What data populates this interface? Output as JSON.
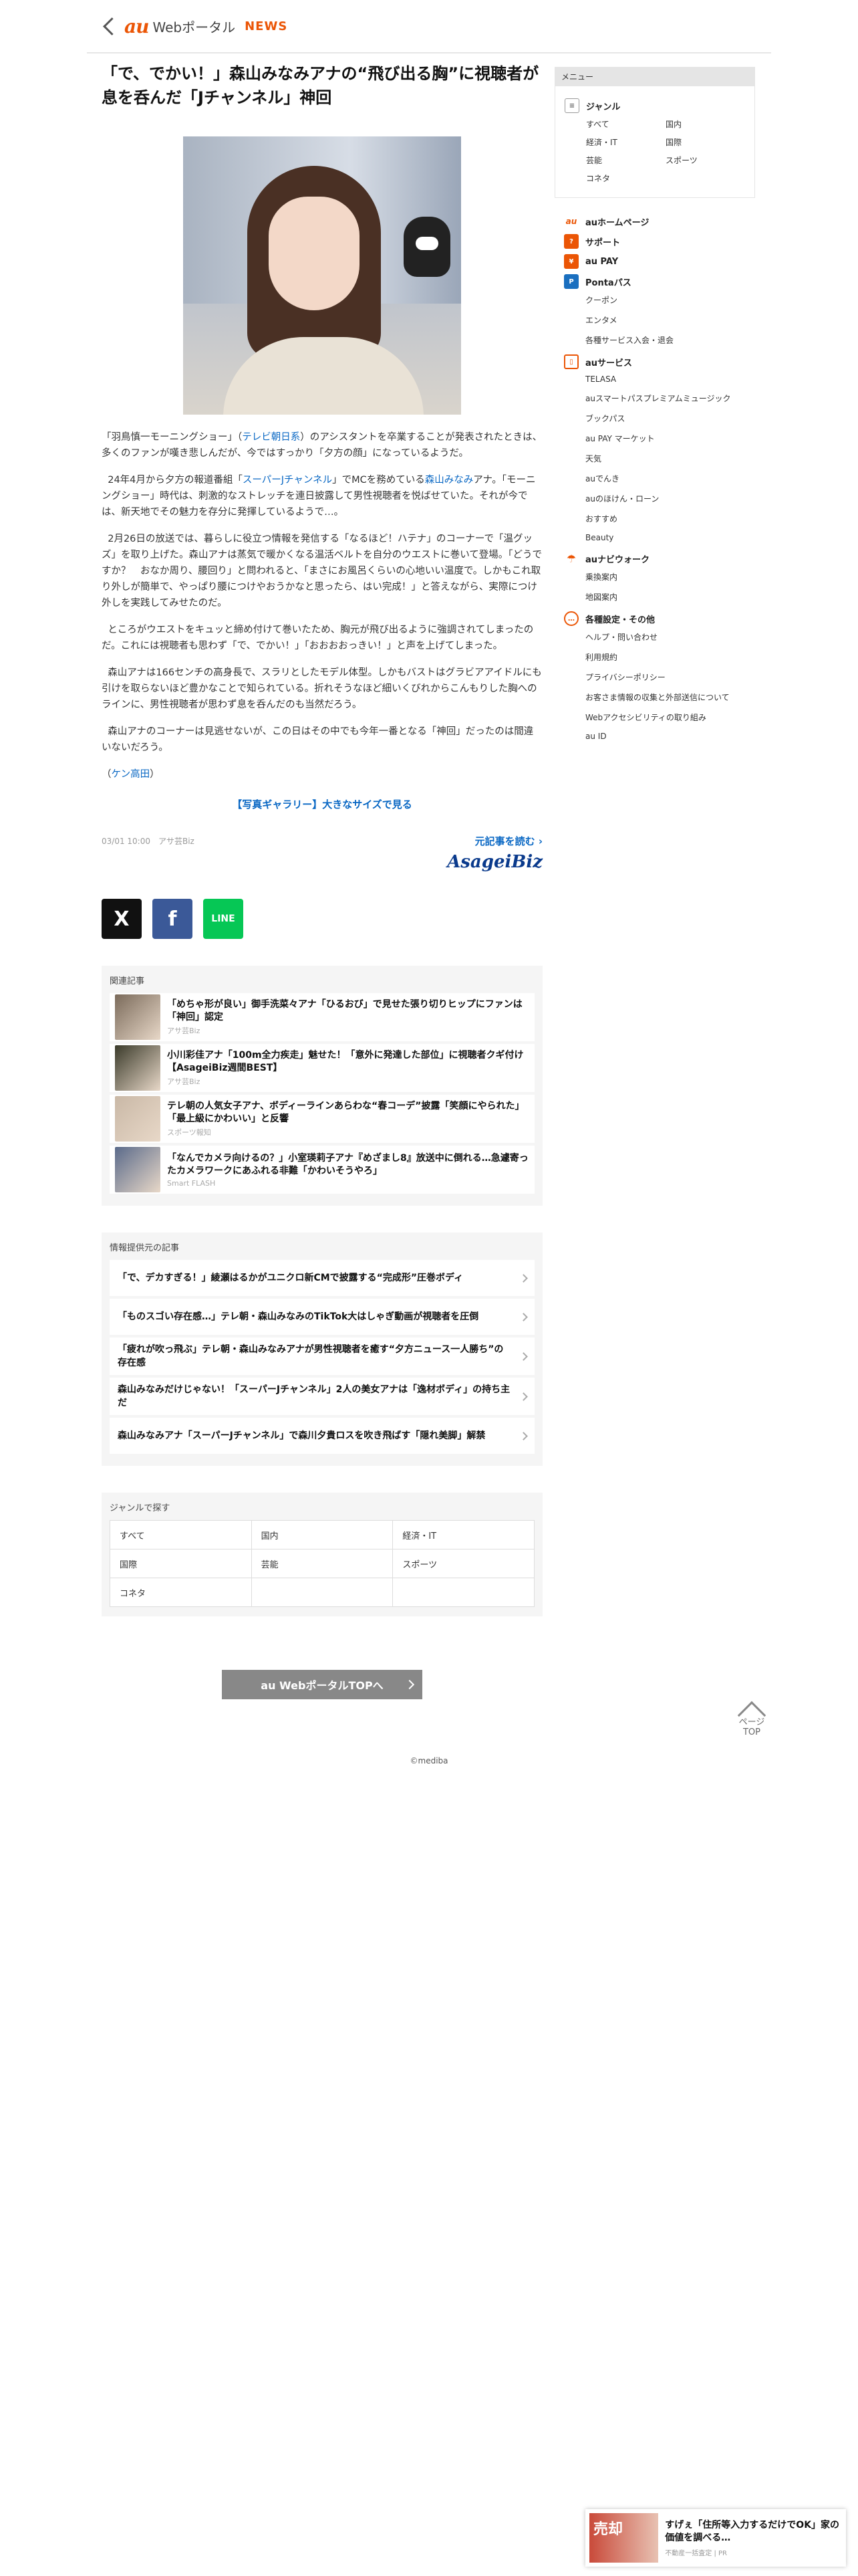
{
  "header": {
    "logo_au": "au",
    "logo_web": "Webポータル",
    "logo_news": "NEWS"
  },
  "article": {
    "title": "「で、でかい！」森山みなみアナの“飛び出る胸”に視聴者が息を呑んだ「Jチャンネル」神回",
    "p1_a": "「羽鳥慎一モーニングショー」（",
    "p1_link": "テレビ朝日系",
    "p1_b": "）のアシスタントを卒業することが発表されたときは、多くのファンが嘆き悲しんだが、今ではすっかり「夕方の顔」になっているようだ。",
    "p2_a": "24年4月から夕方の報道番組「",
    "p2_link1": "スーパーJチャンネル",
    "p2_b": "」でMCを務めている",
    "p2_link2": "森山みなみ",
    "p2_c": "アナ。「モーニングショー」時代は、刺激的なストレッチを連日披露して男性視聴者を悦ばせていた。それが今では、新天地でその魅力を存分に発揮しているようで…。",
    "p3": "2月26日の放送では、暮らしに役立つ情報を発信する「なるほど！ハテナ」のコーナーで「温グッズ」を取り上げた。森山アナは蒸気で暖かくなる温活ベルトを自分のウエストに巻いて登場。「どうですか？　おなか周り、腰回り」と問われると、「まさにお風呂くらいの心地いい温度で。しかもこれ取り外しが簡単で、やっぱり腰につけやおうかなと思ったら、はい完成！」と答えながら、実際につけ外しを実践してみせたのだ。",
    "p4": "ところがウエストをキュッと締め付けて巻いたため、胸元が飛び出るように強調されてしまったのだ。これには視聴者も思わず「で、でかい！」「おおおおっきい！」と声を上げてしまった。",
    "p5": "森山アナは166センチの高身長で、スラリとしたモデル体型。しかもバストはグラビアアイドルにも引けを取らないほど豊かなことで知られている。折れそうなほど細いくびれからこんもりした胸へのラインに、男性視聴者が思わず息を呑んだのも当然だろう。",
    "p6": "森山アナのコーナーは見逃せないが、この日はその中でも今年一番となる「神回」だったのは間違いないだろう。",
    "author_open": "（",
    "author_link": "ケン高田",
    "author_close": "）",
    "gallery": "【写真ギャラリー】大きなサイズで見る",
    "meta": "03/01 10:00　アサ芸Biz",
    "readmore": "元記事を読む",
    "brand": "AsageiBiz"
  },
  "share": {
    "x": "X",
    "fb": "f",
    "line": "LINE"
  },
  "related": {
    "heading": "関連記事",
    "items": [
      {
        "title": "「めちゃ形が良い」御手洗菜々アナ「ひるおび」で見せた張り切りヒップにファンは「神回」認定",
        "src": "アサ芸Biz",
        "color": "#7a6a5a"
      },
      {
        "title": "小川彩佳アナ「100m全力疾走」魅せた！「意外に発達した部位」に視聴者クギ付け【AsageiBiz週間BEST】",
        "src": "アサ芸Biz",
        "color": "#3a3a2a"
      },
      {
        "title": "テレ朝の人気女子アナ、ボディーラインあらわな“春コーデ”披露「笑顔にやられた」「最上級にかわいい」と反響",
        "src": "スポーツ報知",
        "color": "#c9b8a6"
      },
      {
        "title": "「なんでカメラ向けるの？」小室瑛莉子アナ『めざまし8』放送中に倒れる…急遽寄ったカメラワークにあふれる非難「かわいそうやろ」",
        "src": "Smart FLASH",
        "color": "#5a6a8a"
      }
    ]
  },
  "provider": {
    "heading": "情報提供元の記事",
    "items": [
      "「で、デカすぎる！」綾瀬はるかがユニクロ新CMで披露する“完成形”圧巻ボディ",
      "「ものスゴい存在感…」テレ朝・森山みなみのTikTok大はしゃぎ動画が視聴者を圧倒",
      "「疲れが吹っ飛ぶ」テレ朝・森山みなみアナが男性視聴者を癒す“夕方ニュース一人勝ち”の存在感",
      "森山みなみだけじゃない！「スーパーJチャンネル」2人の美女アナは「逸材ボディ」の持ち主だ",
      "森山みなみアナ「スーパーJチャンネル」で森川夕貴ロスを吹き飛ばす「隠れ美脚」解禁"
    ]
  },
  "genre": {
    "heading": "ジャンルで探す",
    "items": [
      "すべて",
      "国内",
      "経済・IT",
      "国際",
      "芸能",
      "スポーツ",
      "コネタ"
    ]
  },
  "top_button": "au WebポータルTOPへ",
  "pagetop": {
    "line1": "ページ",
    "line2": "TOP"
  },
  "copyright": "©mediba",
  "sidebar": {
    "menu_label": "メニュー",
    "genre_label": "ジャンル",
    "genre_items": [
      "すべて",
      "国内",
      "経済・IT",
      "国際",
      "芸能",
      "スポーツ",
      "コネタ"
    ],
    "au_home": "auホームページ",
    "support": "サポート",
    "aupay": "au PAY",
    "ponta": "Pontaパス",
    "ponta_items": [
      "クーポン",
      "エンタメ",
      "各種サービス入会・退会"
    ],
    "au_service": "auサービス",
    "service_items": [
      "TELASA",
      "auスマートパスプレミアムミュージック",
      "ブックパス",
      "au PAY マーケット",
      "天気",
      "auでんき",
      "auのほけん・ローン",
      "おすすめ",
      "Beauty"
    ],
    "navi": "auナビウォーク",
    "navi_items": [
      "乗換案内",
      "地図案内"
    ],
    "settings": "各種設定・その他",
    "settings_items": [
      "ヘルプ・問い合わせ",
      "利用規約",
      "プライバシーポリシー",
      "お客さま情報の収集と外部送信について",
      "Webアクセシビリティの取り組み",
      "au ID"
    ]
  },
  "ad": {
    "badge": "売却",
    "title": "すげぇ「住所等入力するだけでOK」家の価値を調べる…",
    "src": "不動産一括査定 | PR"
  },
  "colors": {
    "accent": "#eb5505",
    "link": "#0a68c4"
  }
}
